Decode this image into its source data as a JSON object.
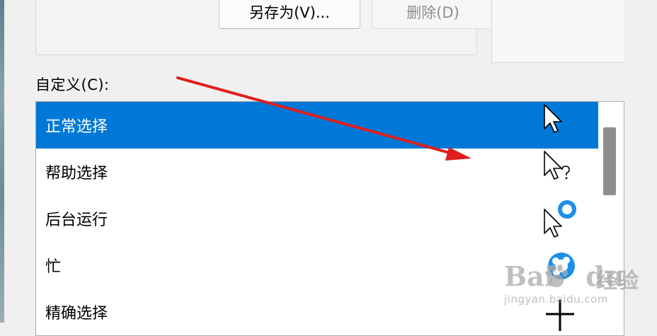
{
  "scheme_buttons": {
    "save_as": "另存为(V)...",
    "delete": "删除(D)"
  },
  "custom": {
    "label": "自定义(C):",
    "items": [
      {
        "label": "正常选择",
        "icon": "normal-select-cursor-icon",
        "selected": true
      },
      {
        "label": "帮助选择",
        "icon": "help-select-cursor-icon",
        "selected": false
      },
      {
        "label": "后台运行",
        "icon": "working-in-background-cursor-icon",
        "selected": false
      },
      {
        "label": "忙",
        "icon": "busy-cursor-icon",
        "selected": false
      },
      {
        "label": "精确选择",
        "icon": "precision-select-cursor-icon",
        "selected": false
      }
    ]
  },
  "watermark": {
    "brand": "Bai",
    "brand_tail": "du",
    "cn": "经验",
    "url": "jingyan.baidu.com"
  },
  "colors": {
    "selection": "#0078d7",
    "annotation_arrow": "#e01e1e",
    "busy_blue": "#1e90e8"
  }
}
